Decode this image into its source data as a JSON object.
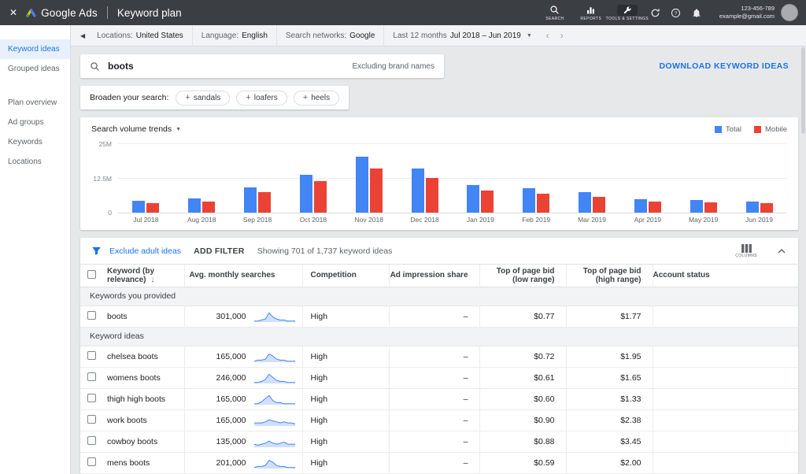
{
  "topbar": {
    "brand": "Google Ads",
    "title": "Keyword plan",
    "nav_icons": [
      {
        "label": "SEARCH",
        "icon": "search-icon"
      },
      {
        "label": "REPORTS",
        "icon": "reports-icon"
      },
      {
        "label": "TOOLS & SETTINGS",
        "icon": "tools-icon",
        "highlight": true
      }
    ],
    "account_id": "123-456-789",
    "account_email": "example@gmail.com"
  },
  "filterbar": {
    "items": [
      {
        "label": "Locations:",
        "value": "United States"
      },
      {
        "label": "Language:",
        "value": "English"
      },
      {
        "label": "Search networks:",
        "value": "Google"
      },
      {
        "label": "Last 12 months",
        "value": "Jul 2018 – Jun 2019",
        "dropdown": true
      }
    ]
  },
  "sidebar": {
    "items": [
      {
        "label": "Keyword ideas",
        "active": true
      },
      {
        "label": "Grouped ideas"
      },
      {
        "label": "Plan overview",
        "gap": true
      },
      {
        "label": "Ad groups"
      },
      {
        "label": "Keywords"
      },
      {
        "label": "Locations"
      }
    ]
  },
  "search": {
    "query": "boots",
    "note": "Excluding brand names",
    "download_label": "DOWNLOAD KEYWORD IDEAS"
  },
  "broaden": {
    "label": "Broaden your search:",
    "chips": [
      "sandals",
      "loafers",
      "heels"
    ]
  },
  "colors": {
    "accent": "#1a73e8",
    "bar_total": "#4285f4",
    "bar_mobile": "#ea4335"
  },
  "chart_data": {
    "type": "bar",
    "title": "Search volume trends",
    "categories": [
      "Jul 2018",
      "Aug 2018",
      "Sep 2018",
      "Oct 2018",
      "Nov 2018",
      "Dec 2018",
      "Jan 2019",
      "Feb 2019",
      "Mar 2019",
      "Apr 2019",
      "May 2019",
      "Jun 2019"
    ],
    "series": [
      {
        "name": "Total",
        "color": "#4285f4",
        "values": [
          4.3,
          5.2,
          9.0,
          13.6,
          20.1,
          16.0,
          10.0,
          8.7,
          7.3,
          4.9,
          4.6,
          4.1
        ]
      },
      {
        "name": "Mobile",
        "color": "#ea4335",
        "values": [
          3.3,
          4.1,
          7.3,
          11.4,
          15.8,
          12.5,
          7.9,
          6.8,
          5.7,
          4.1,
          3.8,
          3.3
        ]
      }
    ],
    "unit": "M",
    "ylim": [
      0,
      25
    ],
    "yticks": [
      "25M",
      "12.5M",
      "0"
    ],
    "grid": true,
    "legend_position": "top-right"
  },
  "toolbar": {
    "exclude_label": "Exclude adult ideas",
    "add_filter_label": "ADD FILTER",
    "showing_label": "Showing 701 of 1,737 keyword ideas",
    "columns_label": "COLUMNS"
  },
  "table": {
    "headers": [
      "Keyword (by relevance)",
      "Avg. monthly searches",
      "Competition",
      "Ad impression share",
      "Top of page bid (low range)",
      "Top of page bid (high range)",
      "Account status"
    ],
    "sort_column": "Keyword (by relevance)",
    "sections": [
      {
        "label": "Keywords you provided",
        "rows": [
          {
            "keyword": "boots",
            "avg_monthly_searches": "301,000",
            "spark": [
              1,
              1,
              2,
              3,
              9,
              5,
              3,
              2,
              2,
              1,
              1,
              1
            ],
            "competition": "High",
            "ad_impression_share": "–",
            "bid_low": "$0.77",
            "bid_high": "$1.77",
            "account_status": ""
          }
        ]
      },
      {
        "label": "Keyword ideas",
        "rows": [
          {
            "keyword": "chelsea boots",
            "avg_monthly_searches": "165,000",
            "spark": [
              1,
              2,
              2,
              3,
              8,
              6,
              3,
              2,
              2,
              1,
              1,
              1
            ],
            "competition": "High",
            "ad_impression_share": "–",
            "bid_low": "$0.72",
            "bid_high": "$1.95",
            "account_status": ""
          },
          {
            "keyword": "womens boots",
            "avg_monthly_searches": "246,000",
            "spark": [
              1,
              1,
              2,
              4,
              9,
              6,
              3,
              2,
              2,
              1,
              1,
              1
            ],
            "competition": "High",
            "ad_impression_share": "–",
            "bid_low": "$0.61",
            "bid_high": "$1.65",
            "account_status": ""
          },
          {
            "keyword": "thigh high boots",
            "avg_monthly_searches": "165,000",
            "spark": [
              1,
              1,
              3,
              6,
              9,
              4,
              2,
              2,
              1,
              1,
              1,
              1
            ],
            "competition": "High",
            "ad_impression_share": "–",
            "bid_low": "$0.60",
            "bid_high": "$1.33",
            "account_status": ""
          },
          {
            "keyword": "work boots",
            "avg_monthly_searches": "165,000",
            "spark": [
              3,
              3,
              3,
              4,
              6,
              5,
              4,
              3,
              4,
              3,
              3,
              2
            ],
            "competition": "High",
            "ad_impression_share": "–",
            "bid_low": "$0.90",
            "bid_high": "$2.38",
            "account_status": ""
          },
          {
            "keyword": "cowboy boots",
            "avg_monthly_searches": "135,000",
            "spark": [
              3,
              2,
              3,
              4,
              6,
              4,
              3,
              4,
              5,
              3,
              3,
              3
            ],
            "competition": "High",
            "ad_impression_share": "–",
            "bid_low": "$0.88",
            "bid_high": "$3.45",
            "account_status": ""
          },
          {
            "keyword": "mens boots",
            "avg_monthly_searches": "201,000",
            "spark": [
              1,
              2,
              2,
              3,
              8,
              6,
              3,
              2,
              2,
              1,
              1,
              1
            ],
            "competition": "High",
            "ad_impression_share": "–",
            "bid_low": "$0.59",
            "bid_high": "$2.00",
            "account_status": ""
          }
        ]
      }
    ]
  }
}
